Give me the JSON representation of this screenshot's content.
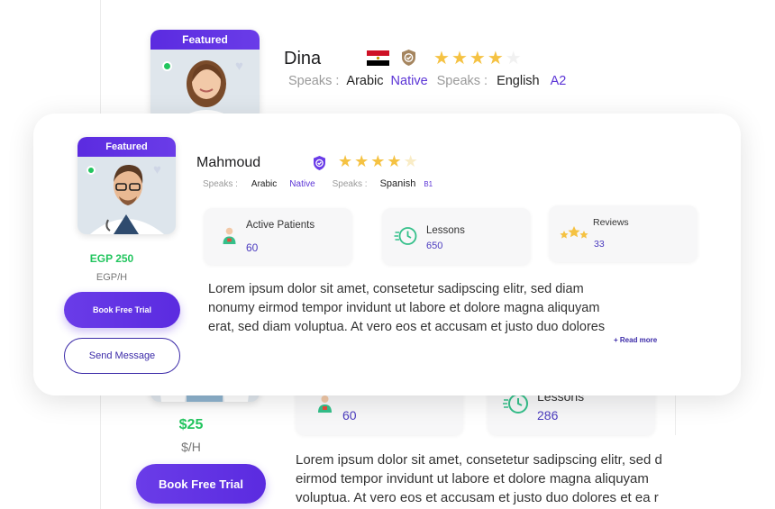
{
  "background_card": {
    "featured_label": "Featured",
    "name": "Dina",
    "speaks_label": "Speaks :",
    "language1": "Arabic",
    "level1": "Native",
    "language2": "English",
    "level2": "A2",
    "rating_stars": 4,
    "stat1_value": "60",
    "stat2_label": "Lessons",
    "stat2_value": "286",
    "price": "$25",
    "price_unit": "$/H",
    "book_button": "Book Free Trial",
    "desc_line1": "Lorem ipsum dolor sit amet, consetetur sadipscing elitr, sed d",
    "desc_line2": "eirmod tempor invidunt ut labore et dolore magna aliquyam",
    "desc_line3": "voluptua. At vero eos et accusam et justo duo dolores et ea r"
  },
  "front_card": {
    "featured_label": "Featured",
    "name": "Mahmoud",
    "speaks_label": "Speaks :",
    "language1": "Arabic",
    "level1": "Native",
    "language2": "Spanish",
    "level2": "B1",
    "rating_stars": 4,
    "stats": [
      {
        "label": "Active Patients",
        "value": "60"
      },
      {
        "label": "Lessons",
        "value": "650"
      },
      {
        "label": "Reviews",
        "value": "33"
      }
    ],
    "price": "EGP 250",
    "price_unit": "EGP/H",
    "book_button": "Book Free Trial",
    "message_button": "Send Message",
    "desc_line1": "Lorem ipsum dolor sit amet, consetetur sadipscing elitr, sed diam",
    "desc_line2": "nonumy eirmod tempor invidunt ut labore et dolore magna aliquyam",
    "desc_line3": "erat, sed diam voluptua. At vero eos et accusam et justo duo dolores",
    "read_more": "+ Read more"
  },
  "colors": {
    "accent": "#5b2be0",
    "online": "#22c55e",
    "price": "#22c55e",
    "star": "#f5c242"
  },
  "icons": [
    "egypt-flag-icon",
    "verified-badge-icon",
    "star-icon",
    "heart-icon",
    "patient-icon",
    "clock-icon",
    "stars-icon"
  ]
}
